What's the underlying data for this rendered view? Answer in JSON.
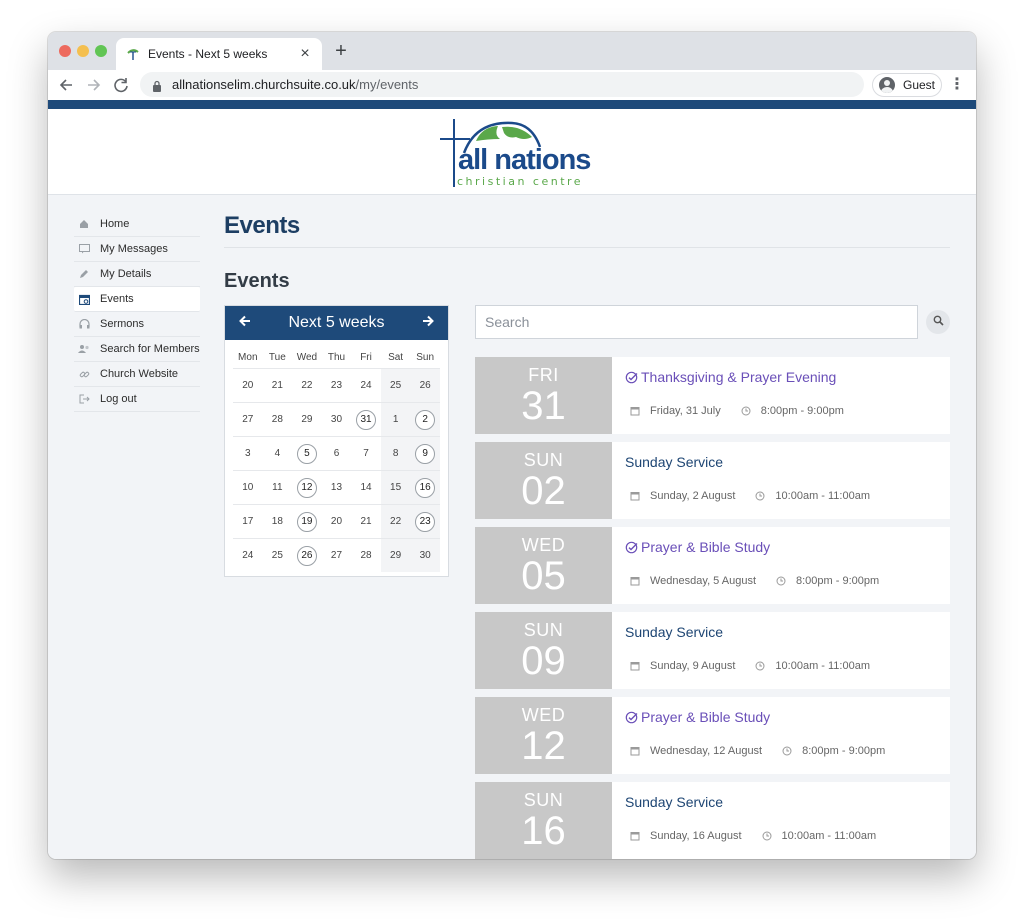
{
  "browser": {
    "tab_title": "Events - Next 5 weeks",
    "url_host": "allnationselim.churchsuite.co.uk",
    "url_path": "/my/events",
    "profile_label": "Guest"
  },
  "logo": {
    "word": "all nations",
    "sub": "christian centre"
  },
  "sidebar": {
    "items": [
      {
        "label": "Home",
        "icon": "home-icon"
      },
      {
        "label": "My Messages",
        "icon": "message-icon"
      },
      {
        "label": "My Details",
        "icon": "pencil-icon"
      },
      {
        "label": "Events",
        "icon": "calendar-icon",
        "active": true
      },
      {
        "label": "Sermons",
        "icon": "headphones-icon"
      },
      {
        "label": "Search for Members",
        "icon": "members-icon"
      },
      {
        "label": "Church Website",
        "icon": "link-icon"
      },
      {
        "label": "Log out",
        "icon": "logout-icon"
      }
    ]
  },
  "main": {
    "page_title": "Events",
    "section_title": "Events"
  },
  "calendar": {
    "title": "Next 5 weeks",
    "dows": [
      "Mon",
      "Tue",
      "Wed",
      "Thu",
      "Fri",
      "Sat",
      "Sun"
    ],
    "weeks": [
      [
        {
          "d": "20"
        },
        {
          "d": "21"
        },
        {
          "d": "22"
        },
        {
          "d": "23"
        },
        {
          "d": "24"
        },
        {
          "d": "25"
        },
        {
          "d": "26"
        }
      ],
      [
        {
          "d": "27"
        },
        {
          "d": "28"
        },
        {
          "d": "29"
        },
        {
          "d": "30"
        },
        {
          "d": "31",
          "e": true
        },
        {
          "d": "1"
        },
        {
          "d": "2",
          "e": true
        }
      ],
      [
        {
          "d": "3"
        },
        {
          "d": "4"
        },
        {
          "d": "5",
          "e": true
        },
        {
          "d": "6"
        },
        {
          "d": "7"
        },
        {
          "d": "8"
        },
        {
          "d": "9",
          "e": true
        }
      ],
      [
        {
          "d": "10"
        },
        {
          "d": "11"
        },
        {
          "d": "12",
          "e": true
        },
        {
          "d": "13"
        },
        {
          "d": "14"
        },
        {
          "d": "15"
        },
        {
          "d": "16",
          "e": true
        }
      ],
      [
        {
          "d": "17"
        },
        {
          "d": "18"
        },
        {
          "d": "19",
          "e": true
        },
        {
          "d": "20"
        },
        {
          "d": "21"
        },
        {
          "d": "22"
        },
        {
          "d": "23",
          "e": true
        }
      ],
      [
        {
          "d": "24"
        },
        {
          "d": "25"
        },
        {
          "d": "26",
          "e": true
        },
        {
          "d": "27"
        },
        {
          "d": "28"
        },
        {
          "d": "29"
        },
        {
          "d": "30"
        }
      ]
    ]
  },
  "search": {
    "placeholder": "Search"
  },
  "events": [
    {
      "dow": "FRI",
      "day": "31",
      "title": "Thanksgiving & Prayer Evening",
      "registered": true,
      "date": "Friday, 31 July",
      "time": "8:00pm - 9:00pm"
    },
    {
      "dow": "SUN",
      "day": "02",
      "title": "Sunday Service",
      "registered": false,
      "date": "Sunday, 2 August",
      "time": "10:00am - 11:00am"
    },
    {
      "dow": "WED",
      "day": "05",
      "title": "Prayer & Bible Study",
      "registered": true,
      "date": "Wednesday, 5 August",
      "time": "8:00pm - 9:00pm"
    },
    {
      "dow": "SUN",
      "day": "09",
      "title": "Sunday Service",
      "registered": false,
      "date": "Sunday, 9 August",
      "time": "10:00am - 11:00am"
    },
    {
      "dow": "WED",
      "day": "12",
      "title": "Prayer & Bible Study",
      "registered": true,
      "date": "Wednesday, 12 August",
      "time": "8:00pm - 9:00pm"
    },
    {
      "dow": "SUN",
      "day": "16",
      "title": "Sunday Service",
      "registered": false,
      "date": "Sunday, 16 August",
      "time": "10:00am - 11:00am"
    }
  ],
  "colors": {
    "brand_blue": "#1e4a7a",
    "registered_purple": "#6a4fb8",
    "date_block_grey": "#c8c8c8"
  }
}
